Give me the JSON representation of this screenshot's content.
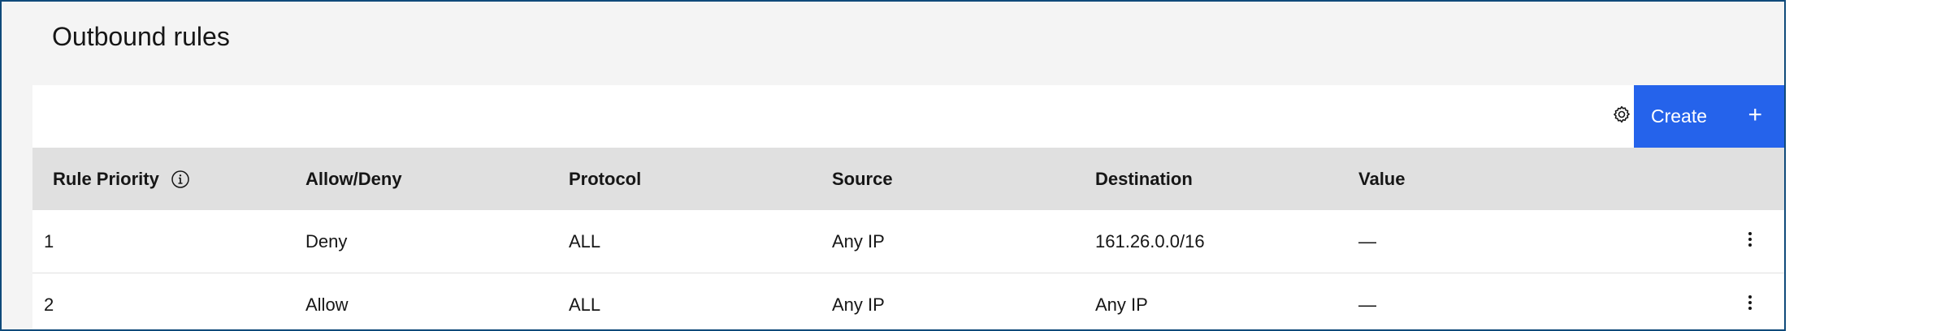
{
  "panel": {
    "title": "Outbound rules"
  },
  "toolbar": {
    "settings_icon": "gear-icon",
    "create_label": "Create",
    "create_icon": "+"
  },
  "table": {
    "headers": [
      "Rule Priority",
      "Allow/Deny",
      "Protocol",
      "Source",
      "Destination",
      "Value"
    ],
    "rows": [
      [
        "1",
        "Deny",
        "ALL",
        "Any IP",
        "161.26.0.0/16",
        "—"
      ],
      [
        "2",
        "Allow",
        "ALL",
        "Any IP",
        "Any IP",
        "—"
      ]
    ]
  },
  "colors": {
    "primary": "#2563eb",
    "border": "#0f4a7a",
    "header_bg": "#e0e0e0",
    "panel_bg": "#f4f4f4"
  }
}
